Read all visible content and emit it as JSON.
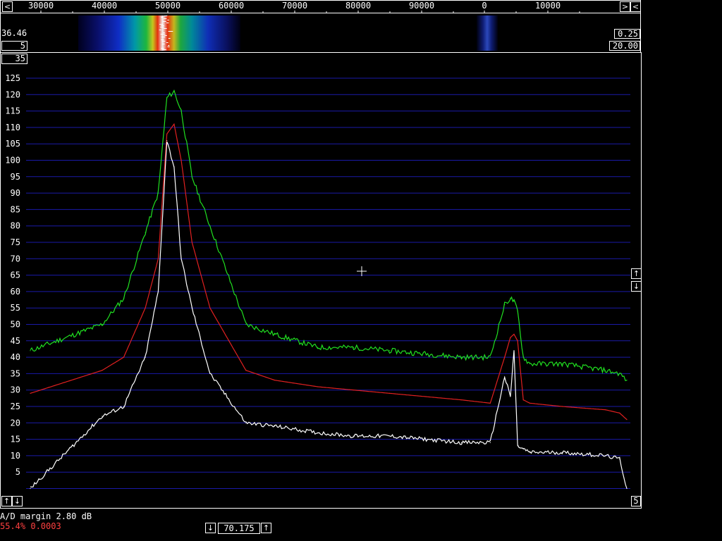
{
  "freq_scale": {
    "ticks": [
      "30000",
      "40000",
      "50000",
      "60000",
      "70000",
      "80000",
      "90000",
      "0",
      "10000"
    ],
    "left_button": "<",
    "right_button_a": ">",
    "right_button_b": "<"
  },
  "waterfall": {
    "left_value": "36.46",
    "left_box": "5",
    "right_top_box": "0.25",
    "right_bottom_box": "20.00"
  },
  "spectrum_panel": {
    "top_box": "35",
    "bottom_right_box": "5",
    "up_button": "↑",
    "down_button": "↓",
    "bottom_left_up": "↑",
    "bottom_left_down": "↓"
  },
  "status": {
    "ad_margin": "A/D margin 2.80 dB",
    "ratio_line": "55.4% 0.0003",
    "ratio_color": "#ff4040"
  },
  "bottom_control": {
    "down_button": "↓",
    "value": "70.175",
    "up_button": "↑"
  },
  "colors": {
    "background": "#000000",
    "grid": "#1a1aa8",
    "white_trace": "#ffffff",
    "red_trace": "#e02020",
    "green_trace": "#20e020"
  },
  "chart_data": {
    "type": "line",
    "ylim": [
      0,
      125
    ],
    "y_ticks": [
      "5",
      "10",
      "15",
      "20",
      "25",
      "30",
      "35",
      "40",
      "45",
      "50",
      "55",
      "60",
      "65",
      "70",
      "75",
      "80",
      "85",
      "90",
      "95",
      "100",
      "105",
      "110",
      "115",
      "120",
      "125"
    ],
    "grid": true,
    "x": [
      30000,
      40000,
      43000,
      46000,
      47800,
      49000,
      50000,
      51000,
      52500,
      55000,
      60000,
      64000,
      70000,
      75000,
      80000,
      90000,
      94000,
      96000,
      96800,
      97300,
      97800,
      98600,
      99500,
      104000,
      110000,
      112000,
      113000
    ],
    "series": [
      {
        "values": [
          42,
          50,
          58,
          78,
          90,
          119,
          121,
          115,
          95,
          80,
          50,
          47,
          43,
          43,
          42,
          40,
          40,
          56,
          58,
          57,
          54,
          40,
          38,
          38,
          36,
          35,
          33
        ]
      },
      {
        "values": [
          29,
          36,
          40,
          55,
          70,
          108,
          111,
          100,
          75,
          55,
          36,
          33,
          31,
          30,
          29,
          27,
          26,
          40,
          46,
          47,
          45,
          27,
          26,
          25,
          24,
          23,
          21
        ]
      },
      {
        "values": [
          0,
          22,
          25,
          40,
          60,
          106,
          98,
          70,
          55,
          35,
          20,
          19,
          17,
          16,
          16,
          14,
          14,
          34,
          28,
          42,
          13,
          12,
          11,
          11,
          10,
          9,
          0
        ]
      }
    ]
  }
}
